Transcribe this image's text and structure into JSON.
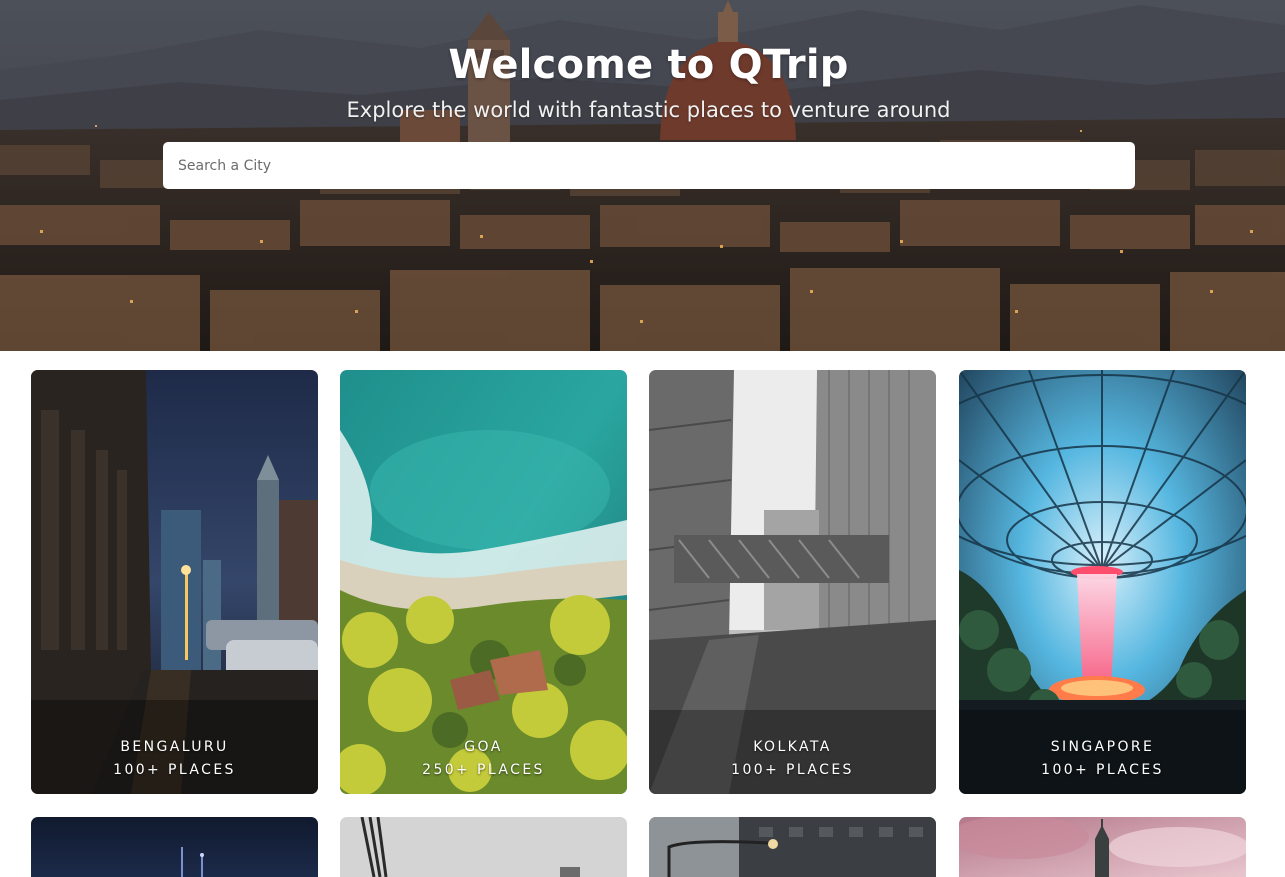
{
  "hero": {
    "title": "Welcome to QTrip",
    "subtitle": "Explore the world with fantastic places to venture around"
  },
  "search": {
    "placeholder": "Search a City",
    "value": ""
  },
  "cities": [
    {
      "name": "BENGALURU",
      "places": "100+ PLACES"
    },
    {
      "name": "GOA",
      "places": "250+ PLACES"
    },
    {
      "name": "KOLKATA",
      "places": "100+ PLACES"
    },
    {
      "name": "SINGAPORE",
      "places": "100+ PLACES"
    }
  ],
  "colors": {
    "card_text": "#ffffff",
    "search_bg": "#ffffff",
    "page_bg": "#ffffff"
  }
}
